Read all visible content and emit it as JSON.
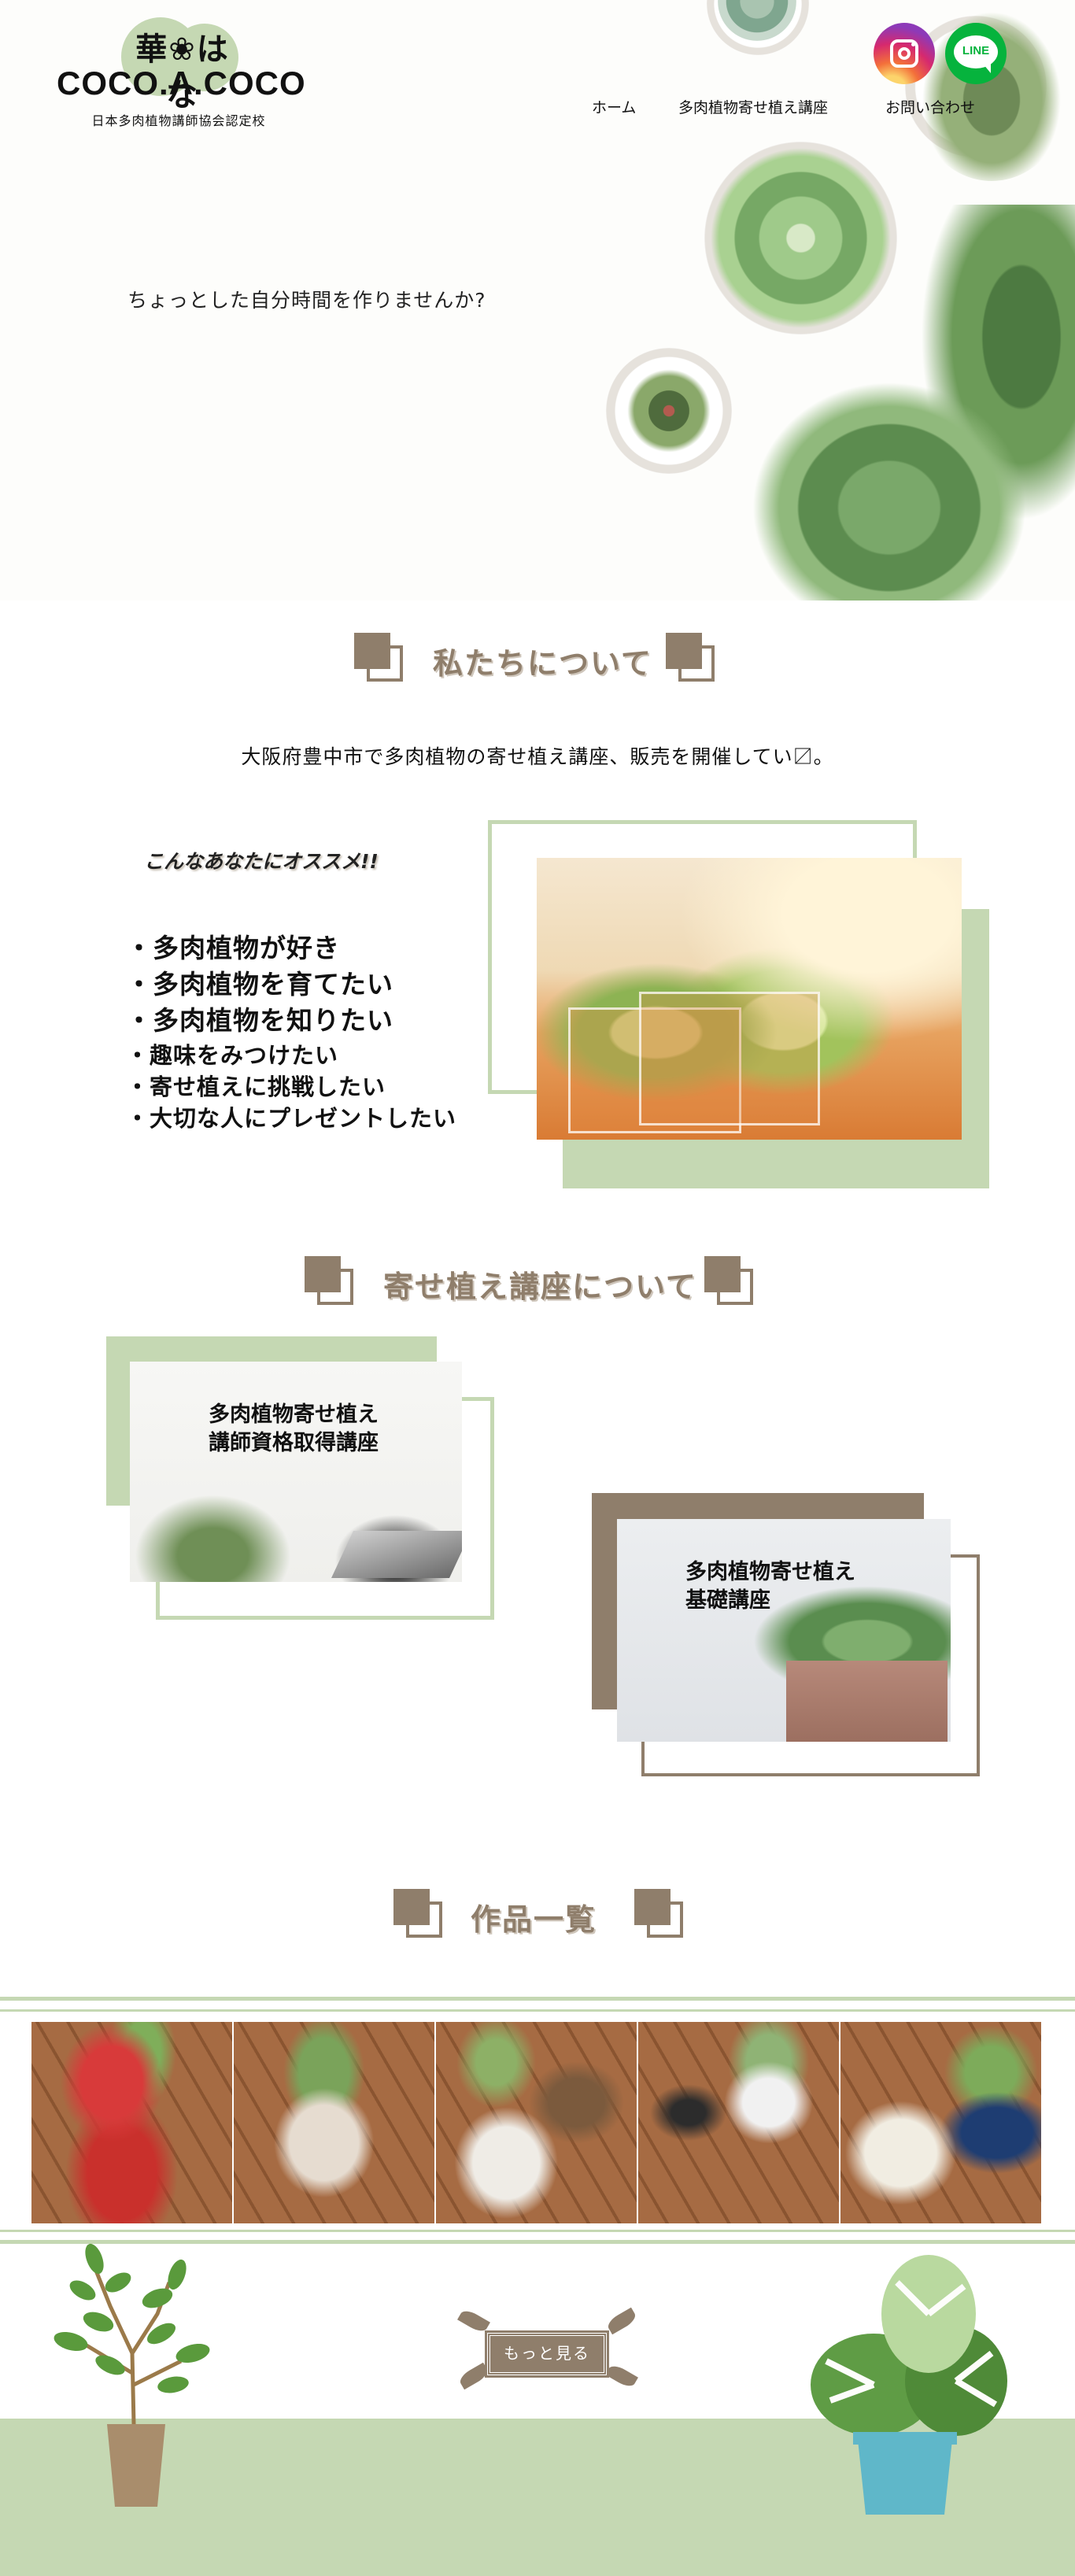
{
  "header": {
    "logo_jp": "華❀はな",
    "logo_en": "COCO.A.COCO",
    "logo_sub": "日本多肉植物講師協会認定校",
    "nav": [
      {
        "label": "ホーム"
      },
      {
        "label": "多肉植物寄せ植え講座"
      },
      {
        "label": "お問い合わせ"
      }
    ],
    "sns": {
      "line_label": "LINE"
    }
  },
  "hero": {
    "tagline": "ちょっとした自分時間を作りませんか?"
  },
  "about": {
    "title": "私たちについて",
    "text": "大阪府豊中市で多肉植物の寄せ植え講座、販売を開催してい〼。",
    "recommend_title": "こんなあなたにオススメ!!",
    "bullets": [
      "・多肉植物が好き",
      "・多肉植物を育てたい",
      "・多肉植物を知りたい",
      "・趣味をみつけたい",
      "・寄せ植えに挑戦したい",
      "・大切な人にプレゼントしたい"
    ]
  },
  "courses": {
    "title": "寄せ植え講座について",
    "items": [
      {
        "line1": "多肉植物寄せ植え",
        "line2": "講師資格取得講座"
      },
      {
        "line1": "多肉植物寄せ植え",
        "line2": "基礎講座"
      }
    ]
  },
  "works": {
    "title": "作品一覧",
    "more_label": "もっと見る"
  },
  "colors": {
    "green": "#c5d8b3",
    "brown": "#8f7e6b"
  }
}
